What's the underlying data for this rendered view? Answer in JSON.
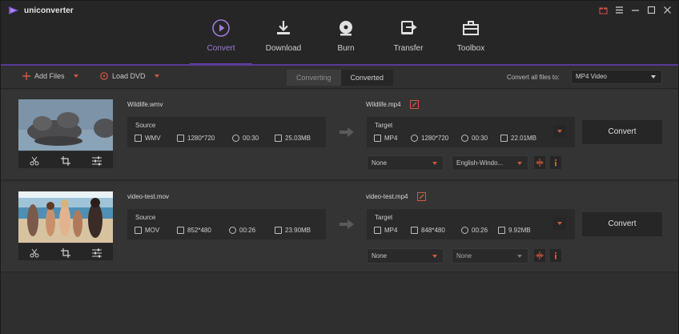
{
  "app": {
    "name": "uniconverter"
  },
  "colors": {
    "accent": "#6a3fb5",
    "orange": "#d05a3f",
    "bg": "#2f2f2f"
  },
  "nav": {
    "tabs": [
      {
        "label": "Convert",
        "icon": "convert-icon",
        "active": true
      },
      {
        "label": "Download",
        "icon": "download-icon",
        "active": false
      },
      {
        "label": "Burn",
        "icon": "burn-icon",
        "active": false
      },
      {
        "label": "Transfer",
        "icon": "transfer-icon",
        "active": false
      },
      {
        "label": "Toolbox",
        "icon": "toolbox-icon",
        "active": false
      }
    ]
  },
  "toolbar": {
    "add_files": "Add Files",
    "load_dvd": "Load DVD",
    "seg_converting": "Converting",
    "seg_converted": "Converted",
    "convert_all_label": "Convert all files to:",
    "convert_all_value": "MP4 Video"
  },
  "files": [
    {
      "source_name": "Wildlife.wmv",
      "source_head": "Source",
      "source_format": "WMV",
      "source_res": "1280*720",
      "source_dur": "00:30",
      "source_size": "25.03MB",
      "target_name": "Wildlife.mp4",
      "target_head": "Target",
      "target_format": "MP4",
      "target_res": "1280*720",
      "target_dur": "00:30",
      "target_size": "22.01MB",
      "subtitle": "None",
      "audio": "English-Windo...",
      "convert": "Convert"
    },
    {
      "source_name": "video-test.mov",
      "source_head": "Source",
      "source_format": "MOV",
      "source_res": "852*480",
      "source_dur": "00:26",
      "source_size": "23.90MB",
      "target_name": "video-test.mp4",
      "target_head": "Target",
      "target_format": "MP4",
      "target_res": "848*480",
      "target_dur": "00:26",
      "target_size": "9.92MB",
      "subtitle": "None",
      "audio": "None",
      "convert": "Convert"
    }
  ]
}
